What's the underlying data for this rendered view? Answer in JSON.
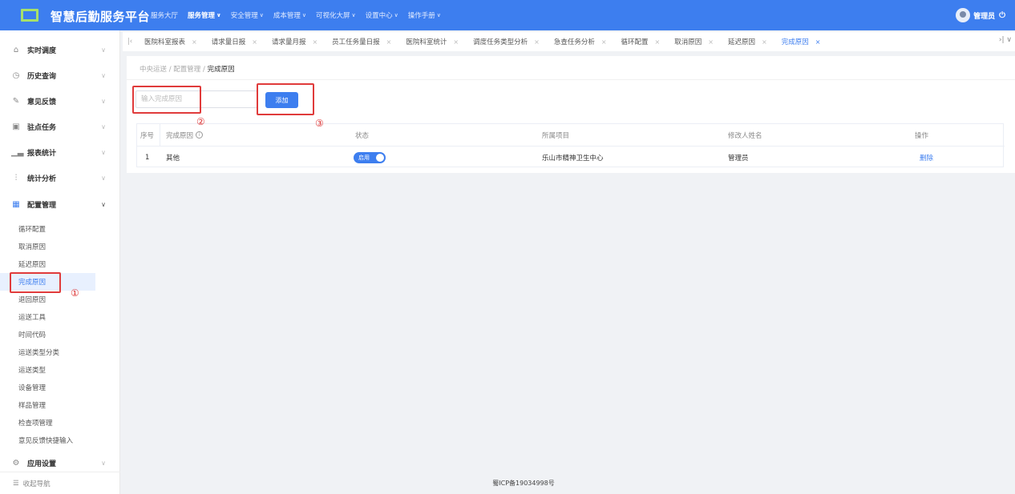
{
  "app": {
    "title": "智慧后勤服务平台"
  },
  "topnav": [
    {
      "label": "服务大厅",
      "chevron": false
    },
    {
      "label": "服务管理",
      "chevron": true,
      "active": true
    },
    {
      "label": "安全管理",
      "chevron": true
    },
    {
      "label": "成本管理",
      "chevron": true
    },
    {
      "label": "可视化大屏",
      "chevron": true
    },
    {
      "label": "设置中心",
      "chevron": true
    },
    {
      "label": "操作手册",
      "chevron": true
    }
  ],
  "user": {
    "name": "管理员"
  },
  "sidebar": {
    "menus": [
      {
        "label": "实时调度",
        "icon": "home-icon"
      },
      {
        "label": "历史查询",
        "icon": "history-icon"
      },
      {
        "label": "意见反馈",
        "icon": "edit-icon"
      },
      {
        "label": "驻点任务",
        "icon": "calendar-icon"
      },
      {
        "label": "报表统计",
        "icon": "bar-chart-icon"
      },
      {
        "label": "统计分析",
        "icon": "analysis-icon"
      },
      {
        "label": "配置管理",
        "icon": "grid-icon",
        "expanded": true
      }
    ],
    "sub_items": [
      "循环配置",
      "取消原因",
      "延迟原因",
      "完成原因",
      "退回原因",
      "运送工具",
      "时间代码",
      "运送类型分类",
      "运送类型",
      "设备管理",
      "样品管理",
      "检查项管理",
      "意见反馈快捷输入"
    ],
    "active_sub": "完成原因",
    "bottom_menu": {
      "label": "应用设置",
      "icon": "settings-icon"
    },
    "collapse_label": "收起导航"
  },
  "tabs": [
    "医院科室报表",
    "请求量日报",
    "请求量月报",
    "员工任务量日报",
    "医院科室统计",
    "调度任务类型分析",
    "急查任务分析",
    "循环配置",
    "取消原因",
    "延迟原因",
    "完成原因"
  ],
  "active_tab": "完成原因",
  "breadcrumb": {
    "root": "中央运送",
    "mid": "配置管理",
    "current": "完成原因"
  },
  "form": {
    "placeholder": "输入完成原因",
    "add_label": "添加"
  },
  "table": {
    "headers": {
      "index": "序号",
      "reason": "完成原因",
      "status": "状态",
      "project": "所属项目",
      "modifier": "修改人姓名",
      "action": "操作"
    },
    "rows": [
      {
        "index": "1",
        "reason": "其他",
        "status": "启用",
        "project": "乐山市精神卫生中心",
        "modifier": "管理员",
        "action": "删除"
      }
    ]
  },
  "annotations": [
    "①",
    "②",
    "③"
  ],
  "footer": "蜀ICP备19034998号",
  "colors": {
    "primary": "#3d7eef",
    "annotation": "#e03b3b"
  }
}
